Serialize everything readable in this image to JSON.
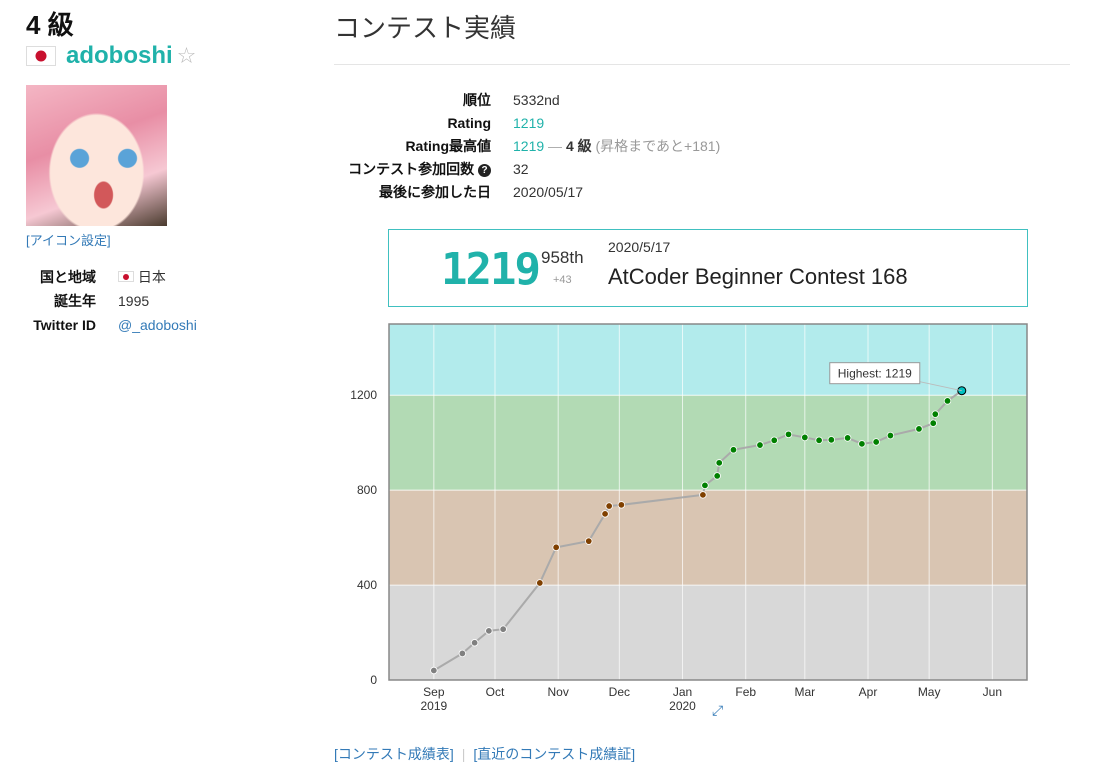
{
  "profile": {
    "kyu": "4 級",
    "username": "adoboshi",
    "star": "☆",
    "icon_setting": "[アイコン設定]",
    "rows": [
      {
        "key": "国と地域",
        "value": "日本",
        "flag": true
      },
      {
        "key": "誕生年",
        "value": "1995"
      },
      {
        "key": "Twitter ID",
        "value": "@_adoboshi",
        "link": true
      }
    ]
  },
  "main": {
    "title": "コンテスト実績",
    "stats": {
      "rank_label": "順位",
      "rank_value": "5332nd",
      "rating_label": "Rating",
      "rating_value": "1219",
      "highest_label": "Rating最高値",
      "highest_value": "1219",
      "highest_dash": "―",
      "highest_kyu": "4 級",
      "highest_note": "(昇格まであと+181)",
      "count_label": "コンテスト参加回数",
      "count_icon": "?",
      "count_value": "32",
      "last_label": "最後に参加した日",
      "last_value": "2020/05/17"
    },
    "status": {
      "rating": "1219",
      "rank": "958th",
      "diff": "+43",
      "date": "2020/5/17",
      "contest": "AtCoder Beginner Contest 168"
    },
    "links": {
      "results": "[コンテスト成績表]",
      "certificate": "[直近のコンテスト成績証]"
    },
    "expand_icon": "⤢"
  },
  "chart_data": {
    "type": "line",
    "title": "",
    "xlabel": "",
    "ylabel": "",
    "ylim": [
      0,
      1500
    ],
    "y_ticks": [
      0,
      400,
      800,
      1200
    ],
    "x_ticks": [
      {
        "date": "2019-09-01",
        "label": "Sep",
        "sub": "2019"
      },
      {
        "date": "2019-10-01",
        "label": "Oct"
      },
      {
        "date": "2019-11-01",
        "label": "Nov"
      },
      {
        "date": "2019-12-01",
        "label": "Dec"
      },
      {
        "date": "2020-01-01",
        "label": "Jan",
        "sub": "2020"
      },
      {
        "date": "2020-02-01",
        "label": "Feb"
      },
      {
        "date": "2020-03-01",
        "label": "Mar"
      },
      {
        "date": "2020-04-01",
        "label": "Apr"
      },
      {
        "date": "2020-05-01",
        "label": "May"
      },
      {
        "date": "2020-06-01",
        "label": "Jun"
      }
    ],
    "x_range": [
      "2019-08-10",
      "2020-06-18"
    ],
    "bands": [
      {
        "from": 0,
        "to": 400,
        "color": "#d8d8d8"
      },
      {
        "from": 400,
        "to": 800,
        "color": "#d9c5b2"
      },
      {
        "from": 800,
        "to": 1200,
        "color": "#b2dab4"
      },
      {
        "from": 1200,
        "to": 1500,
        "color": "#b2ebec"
      }
    ],
    "points": [
      {
        "date": "2019-09-01",
        "y": 40
      },
      {
        "date": "2019-09-15",
        "y": 112
      },
      {
        "date": "2019-09-21",
        "y": 157
      },
      {
        "date": "2019-09-28",
        "y": 207
      },
      {
        "date": "2019-10-05",
        "y": 214
      },
      {
        "date": "2019-10-23",
        "y": 409
      },
      {
        "date": "2019-10-31",
        "y": 559
      },
      {
        "date": "2019-11-16",
        "y": 585
      },
      {
        "date": "2019-11-24",
        "y": 700
      },
      {
        "date": "2019-11-26",
        "y": 733
      },
      {
        "date": "2019-12-02",
        "y": 738
      },
      {
        "date": "2020-01-11",
        "y": 780
      },
      {
        "date": "2020-01-12",
        "y": 820
      },
      {
        "date": "2020-01-18",
        "y": 860
      },
      {
        "date": "2020-01-19",
        "y": 915
      },
      {
        "date": "2020-01-26",
        "y": 970
      },
      {
        "date": "2020-02-08",
        "y": 990
      },
      {
        "date": "2020-02-15",
        "y": 1010
      },
      {
        "date": "2020-02-22",
        "y": 1035
      },
      {
        "date": "2020-03-01",
        "y": 1022
      },
      {
        "date": "2020-03-08",
        "y": 1010
      },
      {
        "date": "2020-03-14",
        "y": 1012
      },
      {
        "date": "2020-03-22",
        "y": 1020
      },
      {
        "date": "2020-03-29",
        "y": 995
      },
      {
        "date": "2020-04-05",
        "y": 1003
      },
      {
        "date": "2020-04-12",
        "y": 1030
      },
      {
        "date": "2020-04-26",
        "y": 1058
      },
      {
        "date": "2020-05-03",
        "y": 1082
      },
      {
        "date": "2020-05-04",
        "y": 1120
      },
      {
        "date": "2020-05-10",
        "y": 1176
      },
      {
        "date": "2020-05-17",
        "y": 1219
      }
    ],
    "point_colors": {
      "gray": "#808080",
      "brown": "#804000",
      "green": "#008000",
      "cyan": "#00c0c0"
    },
    "highlight": {
      "label": "Highest: 1219"
    }
  }
}
